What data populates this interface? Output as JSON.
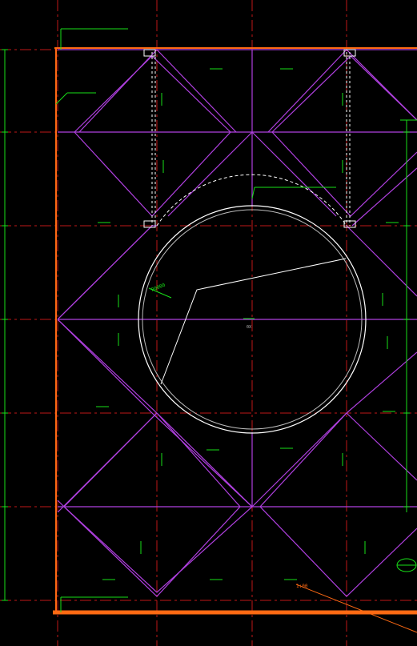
{
  "colors": {
    "background": "#000000",
    "orange": "#ff6a13",
    "purple": "#b040e0",
    "red": "#c01818",
    "green": "#18e018",
    "white": "#ffffff",
    "grey": "#bcbcbc"
  },
  "labels": {
    "dim_label": "R0000",
    "leader_label": "1:00",
    "center_mark": "0X"
  }
}
